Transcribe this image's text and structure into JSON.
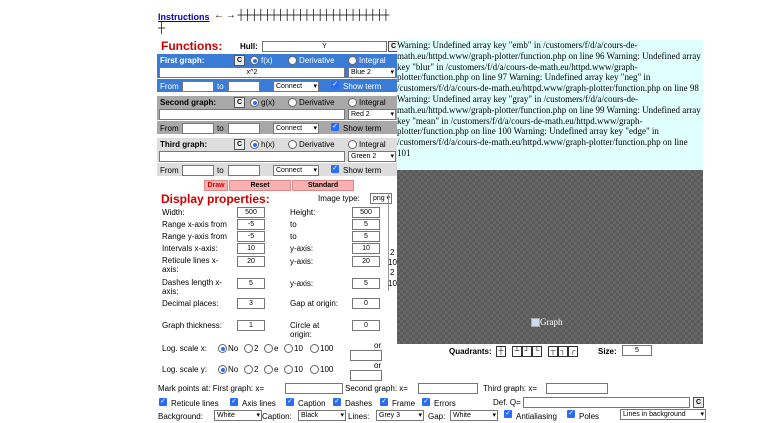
{
  "header": {
    "instructions_link": "Instructions",
    "arrow_row": "← → ┼┼┼┼┼┼┼┼┼┼┼┼┼┼┼┼┼┼┼┼┼┼┼",
    "arrow_row2": "┼"
  },
  "functions": {
    "title": "Functions:",
    "hull_label": "Hull:",
    "hull_value": "Y",
    "c_label": "C",
    "first": {
      "title": "First graph:",
      "opt_f": "f(x)",
      "opt_deriv": "Derivative",
      "opt_integral": "Integral",
      "expr": "x^2",
      "color": "Blue 2",
      "from": "From",
      "to": "to",
      "connect": "Connect",
      "show_term": "Show term"
    },
    "second": {
      "title": "Second graph:",
      "opt_f": "g(x)",
      "opt_deriv": "Derivative",
      "opt_integral": "Integral",
      "color": "Red 2",
      "from": "From",
      "to": "to",
      "connect": "Connect",
      "show_term": "Show term"
    },
    "third": {
      "title": "Third graph:",
      "opt_f": "h(x)",
      "opt_deriv": "Derivative",
      "opt_integral": "Integral",
      "color": "Green 2",
      "from": "From",
      "to": "to",
      "connect": "Connect",
      "show_term": "Show term"
    },
    "buttons": {
      "draw": "Draw",
      "reset": "Reset",
      "standard": "Standard"
    }
  },
  "display": {
    "title": "Display properties:",
    "image_type_label": "Image type:",
    "image_type": "png",
    "width_label": "Width:",
    "width": "500",
    "height_label": "Height:",
    "height": "500",
    "xrange_label": "Range x-axis from",
    "xfrom": "-5",
    "xto_label": "to",
    "xto": "5",
    "yrange_label": "Range y-axis from",
    "yfrom": "-5",
    "yto_label": "to",
    "yto": "5",
    "intervals_label": "Intervals x-axis:",
    "intervals_x": "10",
    "intervals_y_label": "y-axis:",
    "intervals_y": "10",
    "reticule_label": "Reticule lines x-axis:",
    "reticule_x": "20",
    "reticule_y_label": "y-axis:",
    "reticule_y": "20",
    "dashes_label": "Dashes length x-axis:",
    "dashes_x": "5",
    "dashes_y_label": "y-axis:",
    "dashes_y": "5",
    "decimal_label": "Decimal places:",
    "decimal": "3",
    "gap_label": "Gap at origin:",
    "gap": "0",
    "thickness_label": "Graph thickness:",
    "thickness": "1",
    "circle_label": "Circle at origin:",
    "circle": "0",
    "logx_label": "Log. scale x:",
    "logy_label": "Log. scale y:",
    "log_no": "No",
    "log_2": "2",
    "log_e": "e",
    "log_10": "10",
    "log_100": "100",
    "log_or": "or",
    "side_ticks": [
      "2",
      "10",
      "2",
      "10"
    ]
  },
  "warnings": "Warning: Undefined array key \"emb\" in /customers/f/d/a/cours-de-math.eu/httpd.www/graph-plotter/function.php on line 96 Warning: Undefined array key \"blur\" in /customers/f/d/a/cours-de-math.eu/httpd.www/graph-plotter/function.php on line 97 Warning: Undefined array key \"neg\" in /customers/f/d/a/cours-de-math.eu/httpd.www/graph-plotter/function.php on line 98 Warning: Undefined array key \"gray\" in /customers/f/d/a/cours-de-math.eu/httpd.www/graph-plotter/function.php on line 99 Warning: Undefined array key \"mean\" in /customers/f/d/a/cours-de-math.eu/httpd.www/graph-plotter/function.php on line 100 Warning: Undefined array key \"edge\" in /customers/f/d/a/cours-de-math.eu/httpd.www/graph-plotter/function.php on line 101",
  "graph": {
    "alt_text": "Graph"
  },
  "quadrants": {
    "label": "Quadrants:",
    "size_label": "Size:",
    "size": "5"
  },
  "mark": {
    "label": "Mark points at: First graph: x=",
    "second": "Second graph: x=",
    "third": "Third graph: x="
  },
  "options": {
    "reticule": "Reticule lines",
    "axis": "Axis lines",
    "caption": "Caption",
    "dashes": "Dashes",
    "frame": "Frame",
    "errors": "Errors",
    "defq": "Def. Q=",
    "c": "C",
    "background_label": "Background:",
    "background": "White",
    "caption_label": "Caption:",
    "caption_color": "Black",
    "lines_label": "Lines:",
    "lines_color": "Grey 3",
    "gap_label": "Gap:",
    "gap_color": "White",
    "antialiasing": "Antialiasing",
    "poles": "Poles",
    "lines_bg": "Lines in background"
  },
  "colors": {
    "blue_header": "#3a7bd5",
    "gray_header": "#a8a8a8",
    "title_red": "#cc0000",
    "warning_bg": "#e0ffff"
  }
}
